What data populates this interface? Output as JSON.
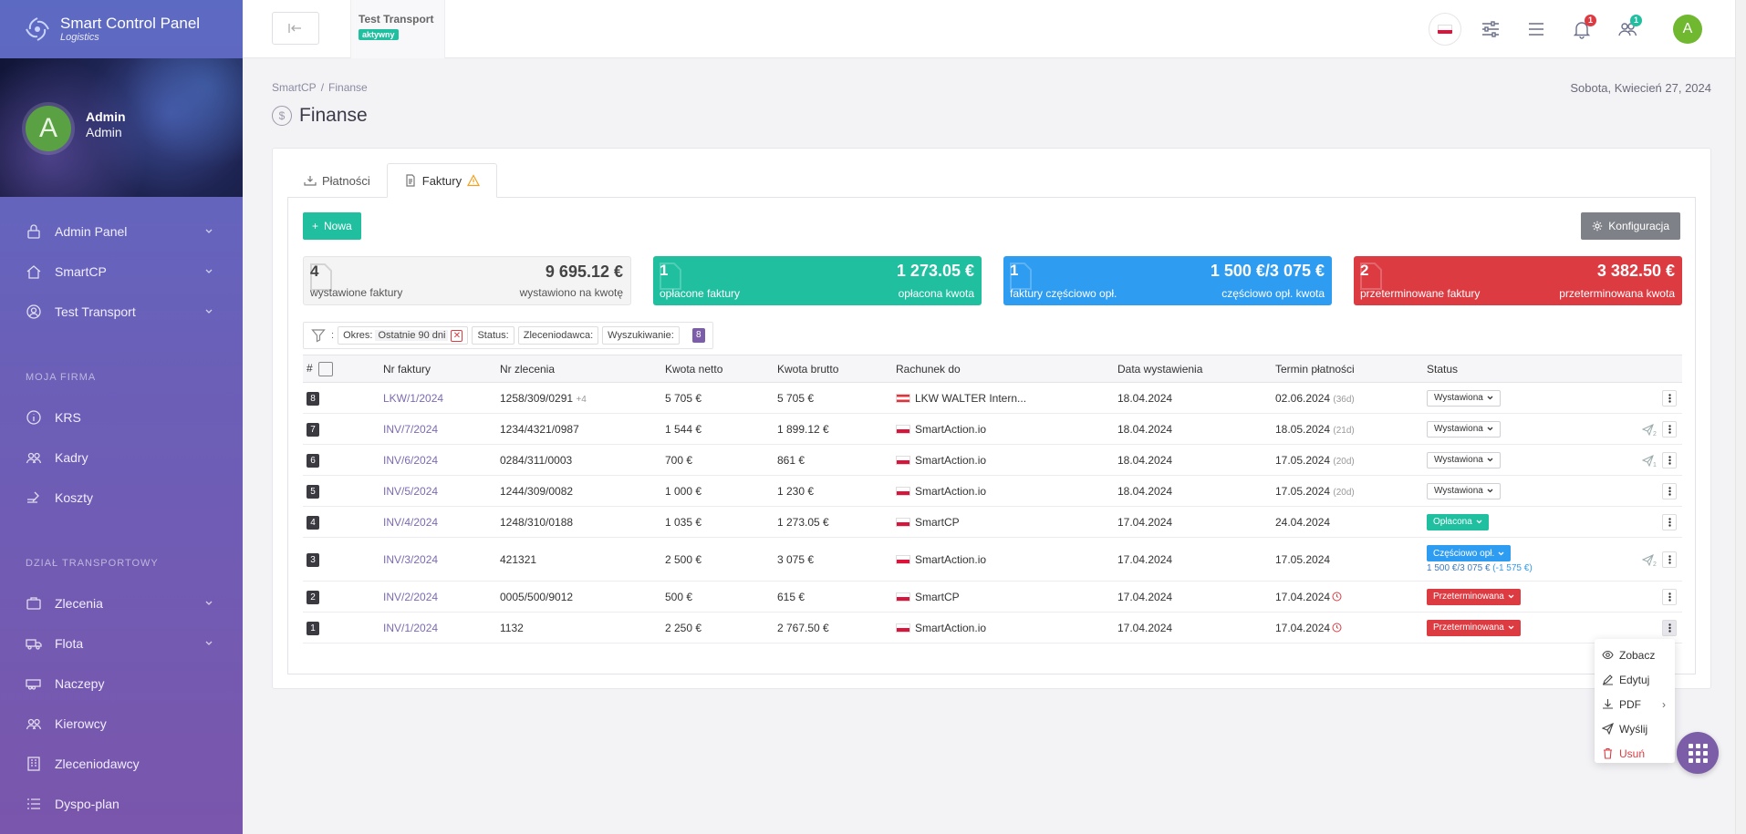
{
  "brand": {
    "title": "Smart Control Panel",
    "subtitle": "Logistics"
  },
  "profile": {
    "initial": "A",
    "name": "Admin",
    "role": "Admin"
  },
  "sidebar": {
    "top_items": [
      {
        "label": "Admin Panel",
        "icon": "lock-icon"
      },
      {
        "label": "SmartCP",
        "icon": "home-icon"
      },
      {
        "label": "Test Transport",
        "icon": "user-circle-icon"
      }
    ],
    "section_company": "MOJA FIRMA",
    "company_items": [
      {
        "label": "KRS",
        "icon": "info-icon"
      },
      {
        "label": "Kadry",
        "icon": "users-icon"
      },
      {
        "label": "Koszty",
        "icon": "coins-icon"
      }
    ],
    "section_transport": "DZIAŁ TRANSPORTOWY",
    "transport_items": [
      {
        "label": "Zlecenia",
        "icon": "briefcase-icon"
      },
      {
        "label": "Flota",
        "icon": "truck-icon"
      },
      {
        "label": "Naczepy",
        "icon": "trailer-icon"
      },
      {
        "label": "Kierowcy",
        "icon": "drivers-icon"
      },
      {
        "label": "Zleceniodawcy",
        "icon": "building-icon"
      },
      {
        "label": "Dyspo-plan",
        "icon": "list-icon"
      }
    ]
  },
  "topbar": {
    "company_name": "Test Transport",
    "company_status": "aktywny",
    "notifications_count": "1",
    "users_count": "1",
    "user_initial": "A"
  },
  "breadcrumb": {
    "root": "SmartCP",
    "current": "Finanse"
  },
  "date": "Sobota, Kwiecień 27, 2024",
  "page_title": "Finanse",
  "tabs": [
    {
      "label": "Płatności"
    },
    {
      "label": "Faktury"
    }
  ],
  "buttons": {
    "new": "Nowa",
    "config": "Konfiguracja"
  },
  "stats": [
    {
      "count": "4",
      "amount": "9 695.12 €",
      "label": "wystawione faktury",
      "sub": "wystawiono na kwotę",
      "color": "#f4f4f5"
    },
    {
      "count": "1",
      "amount": "1 273.05 €",
      "label": "opłacone faktury",
      "sub": "opłacona kwota",
      "color": "#1fbfa0"
    },
    {
      "count": "1",
      "amount": "1 500 €/3 075 €",
      "label": "faktury częściowo opł.",
      "sub": "częściowo opł. kwota",
      "color": "#2e9cf0"
    },
    {
      "count": "2",
      "amount": "3 382.50 €",
      "label": "przeterminowane faktury",
      "sub": "przeterminowana kwota",
      "color": "#dd3b42"
    }
  ],
  "filters": {
    "period_label": "Okres:",
    "period_value": "Ostatnie 90 dni",
    "status_label": "Status:",
    "client_label": "Zleceniodawca:",
    "search_label": "Wyszukiwanie:",
    "count": "8"
  },
  "table": {
    "headers": [
      "#",
      "Nr faktury",
      "Nr zlecenia",
      "Kwota netto",
      "Kwota brutto",
      "Rachunek do",
      "Data wystawienia",
      "Termin płatności",
      "Status"
    ],
    "rows": [
      {
        "n": "8",
        "invoice": "LKW/1/2024",
        "order": "1258/309/0291",
        "order_extra": "+4",
        "net": "5 705 €",
        "gross": "5 705 €",
        "flag": "at",
        "to": "LKW WALTER Intern...",
        "issued": "18.04.2024",
        "due": "02.06.2024",
        "due_note": "(36d)",
        "overdue": false,
        "status": "Wystawiona",
        "status_type": "wyst",
        "sent": "",
        "partial": "",
        "partial_neg": ""
      },
      {
        "n": "7",
        "invoice": "INV/7/2024",
        "order": "1234/4321/0987",
        "order_extra": "",
        "net": "1 544 €",
        "gross": "1 899.12 €",
        "flag": "pl",
        "to": "SmartAction.io",
        "issued": "18.04.2024",
        "due": "18.05.2024",
        "due_note": "(21d)",
        "overdue": false,
        "status": "Wystawiona",
        "status_type": "wyst",
        "sent": "2",
        "partial": "",
        "partial_neg": ""
      },
      {
        "n": "6",
        "invoice": "INV/6/2024",
        "order": "0284/311/0003",
        "order_extra": "",
        "net": "700 €",
        "gross": "861 €",
        "flag": "pl",
        "to": "SmartAction.io",
        "issued": "18.04.2024",
        "due": "17.05.2024",
        "due_note": "(20d)",
        "overdue": false,
        "status": "Wystawiona",
        "status_type": "wyst",
        "sent": "1",
        "partial": "",
        "partial_neg": ""
      },
      {
        "n": "5",
        "invoice": "INV/5/2024",
        "order": "1244/309/0082",
        "order_extra": "",
        "net": "1 000 €",
        "gross": "1 230 €",
        "flag": "pl",
        "to": "SmartAction.io",
        "issued": "18.04.2024",
        "due": "17.05.2024",
        "due_note": "(20d)",
        "overdue": false,
        "status": "Wystawiona",
        "status_type": "wyst",
        "sent": "",
        "partial": "",
        "partial_neg": ""
      },
      {
        "n": "4",
        "invoice": "INV/4/2024",
        "order": "1248/310/0188",
        "order_extra": "",
        "net": "1 035 €",
        "gross": "1 273.05 €",
        "flag": "pl",
        "to": "SmartCP",
        "issued": "17.04.2024",
        "due": "24.04.2024",
        "due_note": "",
        "overdue": false,
        "status": "Opłacona",
        "status_type": "opl",
        "sent": "",
        "partial": "",
        "partial_neg": ""
      },
      {
        "n": "3",
        "invoice": "INV/3/2024",
        "order": "421321",
        "order_extra": "",
        "net": "2 500 €",
        "gross": "3 075 €",
        "flag": "pl",
        "to": "SmartAction.io",
        "issued": "17.04.2024",
        "due": "17.05.2024",
        "due_note": "",
        "overdue": false,
        "status": "Częściowo opł.",
        "status_type": "czes",
        "sent": "2",
        "partial": "1 500 €/3 075 €",
        "partial_neg": "(-1 575 €)"
      },
      {
        "n": "2",
        "invoice": "INV/2/2024",
        "order": "0005/500/9012",
        "order_extra": "",
        "net": "500 €",
        "gross": "615 €",
        "flag": "pl",
        "to": "SmartCP",
        "issued": "17.04.2024",
        "due": "17.04.2024",
        "due_note": "",
        "overdue": true,
        "status": "Przeterminowana",
        "status_type": "przet",
        "sent": "",
        "partial": "",
        "partial_neg": ""
      },
      {
        "n": "1",
        "invoice": "INV/1/2024",
        "order": "1132",
        "order_extra": "",
        "net": "2 250 €",
        "gross": "2 767.50 €",
        "flag": "pl",
        "to": "SmartAction.io",
        "issued": "17.04.2024",
        "due": "17.04.2024",
        "due_note": "",
        "overdue": true,
        "status": "Przeterminowana",
        "status_type": "przet",
        "sent": "",
        "partial": "",
        "partial_neg": ""
      }
    ]
  },
  "context_menu": {
    "view": "Zobacz",
    "edit": "Edytuj",
    "pdf": "PDF",
    "send": "Wyślij",
    "delete": "Usuń"
  },
  "colors": {
    "accent": "#7b5ea7",
    "green": "#1fbfa0",
    "blue": "#2e9cf0",
    "red": "#dd3b42"
  }
}
